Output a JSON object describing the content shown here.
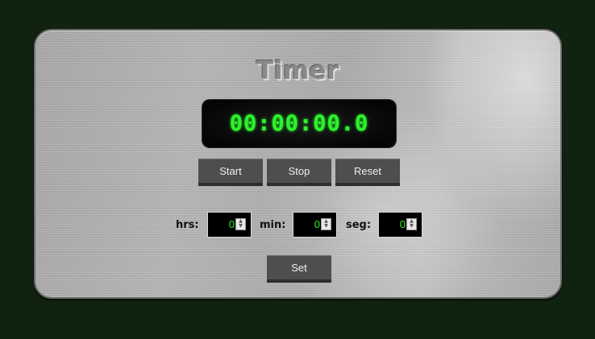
{
  "title": "Timer",
  "display": {
    "time": "00:00:00.0"
  },
  "controls": {
    "start_label": "Start",
    "stop_label": "Stop",
    "reset_label": "Reset"
  },
  "inputs": [
    {
      "label": "hrs:",
      "value": "0"
    },
    {
      "label": "min:",
      "value": "0"
    },
    {
      "label": "seg:",
      "value": "0"
    }
  ],
  "set_label": "Set",
  "colors": {
    "page_background": "#102210",
    "display_digits": "#2cf22c",
    "button": "#4e4e4e",
    "panel": "#b0b0b0"
  }
}
